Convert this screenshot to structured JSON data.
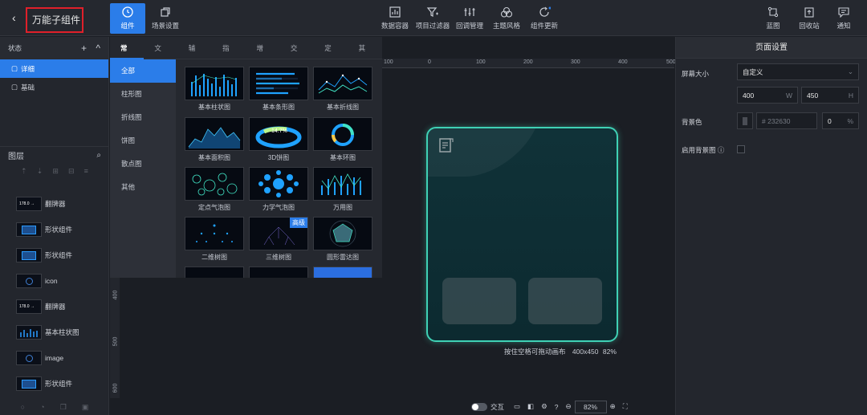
{
  "header": {
    "back_glyph": "‹",
    "title": "万能子组件",
    "tools_left": [
      {
        "label": "组件",
        "icon": "component-icon",
        "active": true
      },
      {
        "label": "场景设置",
        "icon": "scene-icon",
        "active": false
      }
    ],
    "tools_center": [
      {
        "label": "数据容器",
        "icon": "data-container-icon"
      },
      {
        "label": "项目过滤器",
        "icon": "filter-icon"
      },
      {
        "label": "回调管理",
        "icon": "callback-icon"
      },
      {
        "label": "主题风格",
        "icon": "theme-icon"
      },
      {
        "label": "组件更新",
        "icon": "refresh-icon"
      }
    ],
    "tools_right": [
      {
        "label": "蓝图",
        "icon": "blueprint-icon"
      },
      {
        "label": "回收站",
        "icon": "recycle-icon"
      },
      {
        "label": "通知",
        "icon": "notification-icon"
      }
    ]
  },
  "states": {
    "title": "状态",
    "add_glyph": "+",
    "collapse_glyph": "^",
    "items": [
      {
        "label": "详细",
        "selected": true
      },
      {
        "label": "基础",
        "selected": false
      }
    ]
  },
  "layers": {
    "title": "图层",
    "search_glyph": "⌕",
    "items": [
      {
        "label": "翻牌器",
        "thumb": "flip-counter"
      },
      {
        "label": "形状组件",
        "thumb": "shape"
      },
      {
        "label": "形状组件",
        "thumb": "shape"
      },
      {
        "label": "icon",
        "thumb": "icon"
      },
      {
        "label": "翻牌器",
        "thumb": "flip-counter"
      },
      {
        "label": "基本柱状图",
        "thumb": "bar"
      },
      {
        "label": "image",
        "thumb": "image"
      },
      {
        "label": "形状组件",
        "thumb": "shape"
      }
    ],
    "thumb_text": "178.0 →"
  },
  "components": {
    "tabs": [
      "常规",
      "文字",
      "辅助",
      "指标",
      "增值",
      "交互",
      "定制",
      "其他"
    ],
    "categories": [
      "全部",
      "柱形图",
      "折线图",
      "饼图",
      "散点图",
      "其他"
    ],
    "cards": [
      {
        "label": "基本柱状图",
        "kind": "bar"
      },
      {
        "label": "基本条形图",
        "kind": "hbar"
      },
      {
        "label": "基本折线图",
        "kind": "line"
      },
      {
        "label": "基本面积图",
        "kind": "area"
      },
      {
        "label": "3D饼图",
        "kind": "pie3d",
        "text": "14.7%"
      },
      {
        "label": "基本环图",
        "kind": "ring"
      },
      {
        "label": "定点气泡图",
        "kind": "bubble"
      },
      {
        "label": "力学气泡图",
        "kind": "force"
      },
      {
        "label": "万用图",
        "kind": "mixed"
      },
      {
        "label": "二维树图",
        "kind": "tree2d"
      },
      {
        "label": "三维树图",
        "kind": "tree3d",
        "badge": "高级"
      },
      {
        "label": "圆形雷达图",
        "kind": "radar"
      }
    ]
  },
  "ruler": {
    "top": [
      "100",
      "0",
      "100",
      "200",
      "300",
      "400",
      "500"
    ],
    "left": [
      "400",
      "500",
      "600"
    ]
  },
  "canvas": {
    "caption": "按住空格可拖动画布",
    "size": "400x450",
    "zoom": "82%"
  },
  "statusbar": {
    "interaction_label": "交互",
    "zoom_value": "82%"
  },
  "page_settings": {
    "title": "页面设置",
    "screen_size_label": "屏幕大小",
    "screen_size_value": "自定义",
    "width_value": "400",
    "width_suffix": "W",
    "height_value": "450",
    "height_suffix": "H",
    "bg_color_label": "背景色",
    "bg_color_value": "# 232630",
    "opacity_value": "0",
    "opacity_suffix": "%",
    "bg_image_label": "启用背景图"
  },
  "colors": {
    "accent": "#2b7de9",
    "panel": "#23262d",
    "canvas_border": "#3fd1b5",
    "highlight_box": "#e0202a"
  }
}
